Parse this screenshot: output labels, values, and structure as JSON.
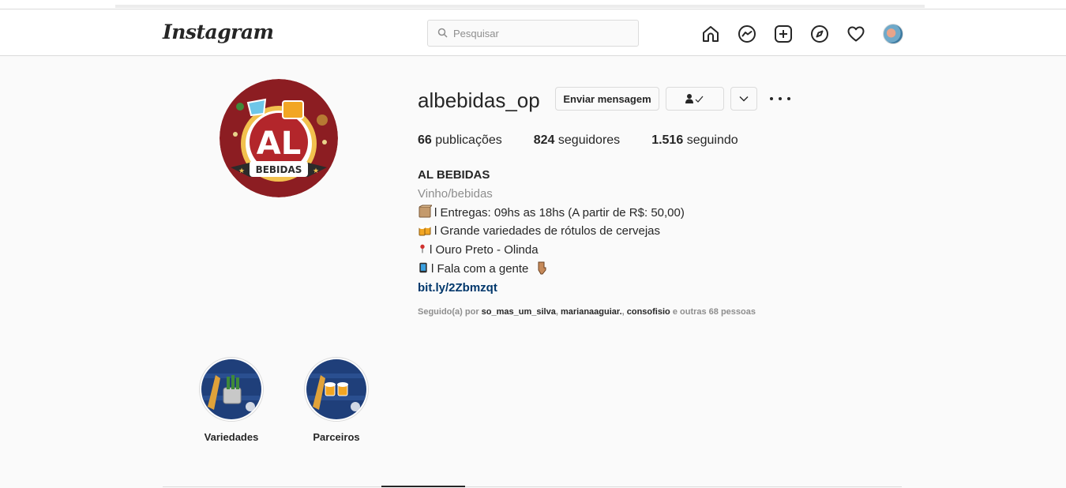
{
  "header": {
    "logo": "Instagram",
    "search_placeholder": "Pesquisar",
    "nav_icons": [
      "home-icon",
      "messenger-icon",
      "new-post-icon",
      "explore-icon",
      "activity-heart-icon",
      "profile-avatar"
    ]
  },
  "profile": {
    "username": "albebidas_op",
    "avatar_text": "AL",
    "avatar_banner": "BEBIDAS",
    "buttons": {
      "message": "Enviar mensagem"
    },
    "stats": {
      "posts_count": "66",
      "posts_label": "publicações",
      "followers_count": "824",
      "followers_label": "seguidores",
      "following_count": "1.516",
      "following_label": "seguindo"
    },
    "bio": {
      "name": "AL BEBIDAS",
      "category": "Vinho/bebidas",
      "line1": "l Entregas: 09hs as 18hs (A partir de R$: 50,00)",
      "line2": "l Grande variedades de rótulos de cervejas",
      "line3": "l Ouro Preto - Olinda",
      "line4": "l Fala com a gente",
      "link": "bit.ly/2Zbmzqt"
    },
    "followed_by": {
      "prefix": "Seguido(a) por",
      "user1": "so_mas_um_silva",
      "user2": "marianaaguiar.",
      "user3": "consofisio",
      "suffix": "e outras 68 pessoas"
    }
  },
  "highlights": [
    {
      "label": "Variedades"
    },
    {
      "label": "Parceiros"
    }
  ],
  "colors": {
    "link": "#00376b",
    "border": "#dbdbdb",
    "secondary_text": "#8e8e8e",
    "brand_red": "#b3262b"
  }
}
